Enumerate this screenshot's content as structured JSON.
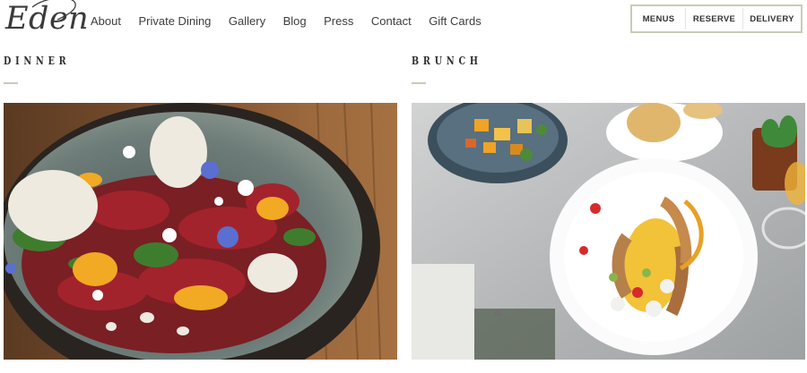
{
  "header": {
    "logo_text": "Eden",
    "nav": [
      "About",
      "Private Dining",
      "Gallery",
      "Blog",
      "Press",
      "Contact",
      "Gift Cards"
    ],
    "buttons": [
      "MENUS",
      "RESERVE",
      "DELIVERY"
    ]
  },
  "sections": [
    {
      "title": "DINNER"
    },
    {
      "title": "BRUNCH"
    }
  ],
  "colors": {
    "button_border": "#c8ccb4",
    "divider": "#c9c9b6"
  }
}
